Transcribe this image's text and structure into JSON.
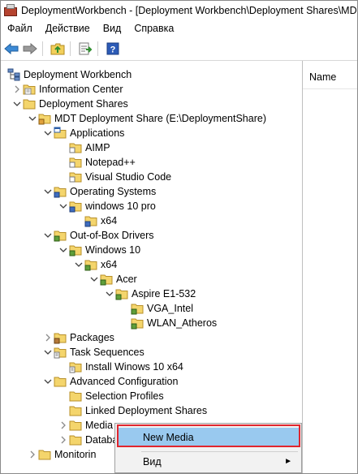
{
  "window": {
    "title": "DeploymentWorkbench - [Deployment Workbench\\Deployment Shares\\MDT D"
  },
  "menubar": {
    "items": [
      "Файл",
      "Действие",
      "Вид",
      "Справка"
    ]
  },
  "toolbar": {
    "icons": [
      "back-arrow-icon",
      "forward-arrow-icon",
      "up-folder-icon",
      "export-list-icon",
      "help-icon"
    ]
  },
  "right_pane": {
    "column_header": "Name"
  },
  "tree": {
    "root": "Deployment Workbench",
    "nodes": [
      {
        "label": "Information Center",
        "toggle": "collapsed"
      },
      {
        "label": "Deployment Shares",
        "toggle": "expanded"
      },
      {
        "label": "MDT Deployment Share (E:\\DeploymentShare)",
        "toggle": "expanded"
      },
      {
        "label": "Applications",
        "toggle": "expanded"
      },
      {
        "label": "AIMP",
        "toggle": "none"
      },
      {
        "label": "Notepad++",
        "toggle": "none"
      },
      {
        "label": "Visual Studio Code",
        "toggle": "none"
      },
      {
        "label": "Operating Systems",
        "toggle": "expanded"
      },
      {
        "label": "windows 10 pro",
        "toggle": "expanded"
      },
      {
        "label": "x64",
        "toggle": "none"
      },
      {
        "label": "Out-of-Box Drivers",
        "toggle": "expanded"
      },
      {
        "label": "Windows 10",
        "toggle": "expanded"
      },
      {
        "label": "x64",
        "toggle": "expanded"
      },
      {
        "label": "Acer",
        "toggle": "expanded"
      },
      {
        "label": "Aspire E1-532",
        "toggle": "expanded"
      },
      {
        "label": "VGA_Intel",
        "toggle": "none"
      },
      {
        "label": "WLAN_Atheros",
        "toggle": "none"
      },
      {
        "label": "Packages",
        "toggle": "collapsed"
      },
      {
        "label": "Task Sequences",
        "toggle": "expanded"
      },
      {
        "label": "Install Winows 10 x64",
        "toggle": "none"
      },
      {
        "label": "Advanced Configuration",
        "toggle": "expanded"
      },
      {
        "label": "Selection Profiles",
        "toggle": "none"
      },
      {
        "label": "Linked Deployment Shares",
        "toggle": "none"
      },
      {
        "label": "Media",
        "toggle": "collapsed"
      },
      {
        "label": "Databa",
        "toggle": "collapsed"
      },
      {
        "label": "Monitorin",
        "toggle": "collapsed"
      }
    ]
  },
  "context_menu": {
    "items": [
      "New Media",
      "Вид"
    ],
    "highlight_color": "#99c9ef",
    "outline_color": "#e0262e"
  }
}
